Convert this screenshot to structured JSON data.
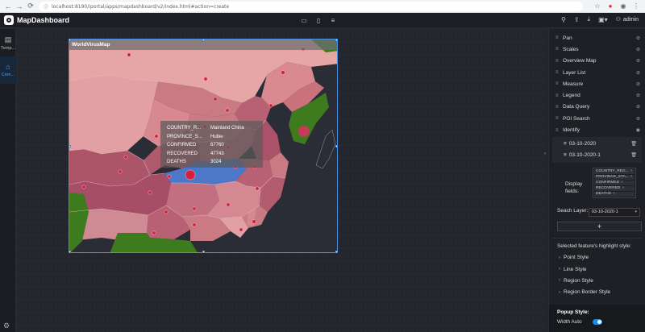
{
  "browser": {
    "url_scheme": "localhost:8190",
    "url_path": "/iportal/apps/mapdashboard/v2/index.html#action=create"
  },
  "header": {
    "app_title": "MapDashboard",
    "user_name": "admin"
  },
  "left_rail": {
    "items": [
      {
        "label": "Temp...",
        "icon": "template-icon"
      },
      {
        "label": "Com...",
        "icon": "home-icon"
      }
    ]
  },
  "map": {
    "title": "WorldVirusMap",
    "popup": [
      {
        "key": "COUNTRY_R...",
        "value": "Mainland China"
      },
      {
        "key": "PROVINCE_S...",
        "value": "Hubei"
      },
      {
        "key": "CONFIRMED",
        "value": "67760"
      },
      {
        "key": "RECOVERED",
        "value": "47743"
      },
      {
        "key": "DEATHS",
        "value": "3024"
      }
    ]
  },
  "panel": {
    "controls": [
      "Pan",
      "Scales",
      "Overview Map",
      "Layer List",
      "Measure",
      "Legend",
      "Data Query",
      "POI Search",
      "Identify"
    ],
    "identify_items": [
      "03-10-2020",
      "03-10-2020-1"
    ],
    "display_fields_label": "Display fields:",
    "display_fields": [
      "COUNTRY_REG...",
      "PROVINCE_STA...",
      "CONFIRMED",
      "RECOVERED",
      "DEATHS"
    ],
    "seach_layer_label": "Seach Layer:",
    "seach_layer_value": "03-10-2020-1",
    "add_label": "+",
    "highlight_label": "Selected feature's highlight style:",
    "styles": [
      "Point Style",
      "Line Style",
      "Region Style",
      "Region Border Style"
    ],
    "popup_style_title": "Popup Style:",
    "width_auto_label": "Width Auto"
  },
  "colors": {
    "accent": "#1e88e5",
    "selection": "#4a90e2",
    "hubei_highlight": "#4d77c9",
    "water": "#2a2d35",
    "land_neighbor": "#3e7a1e"
  }
}
